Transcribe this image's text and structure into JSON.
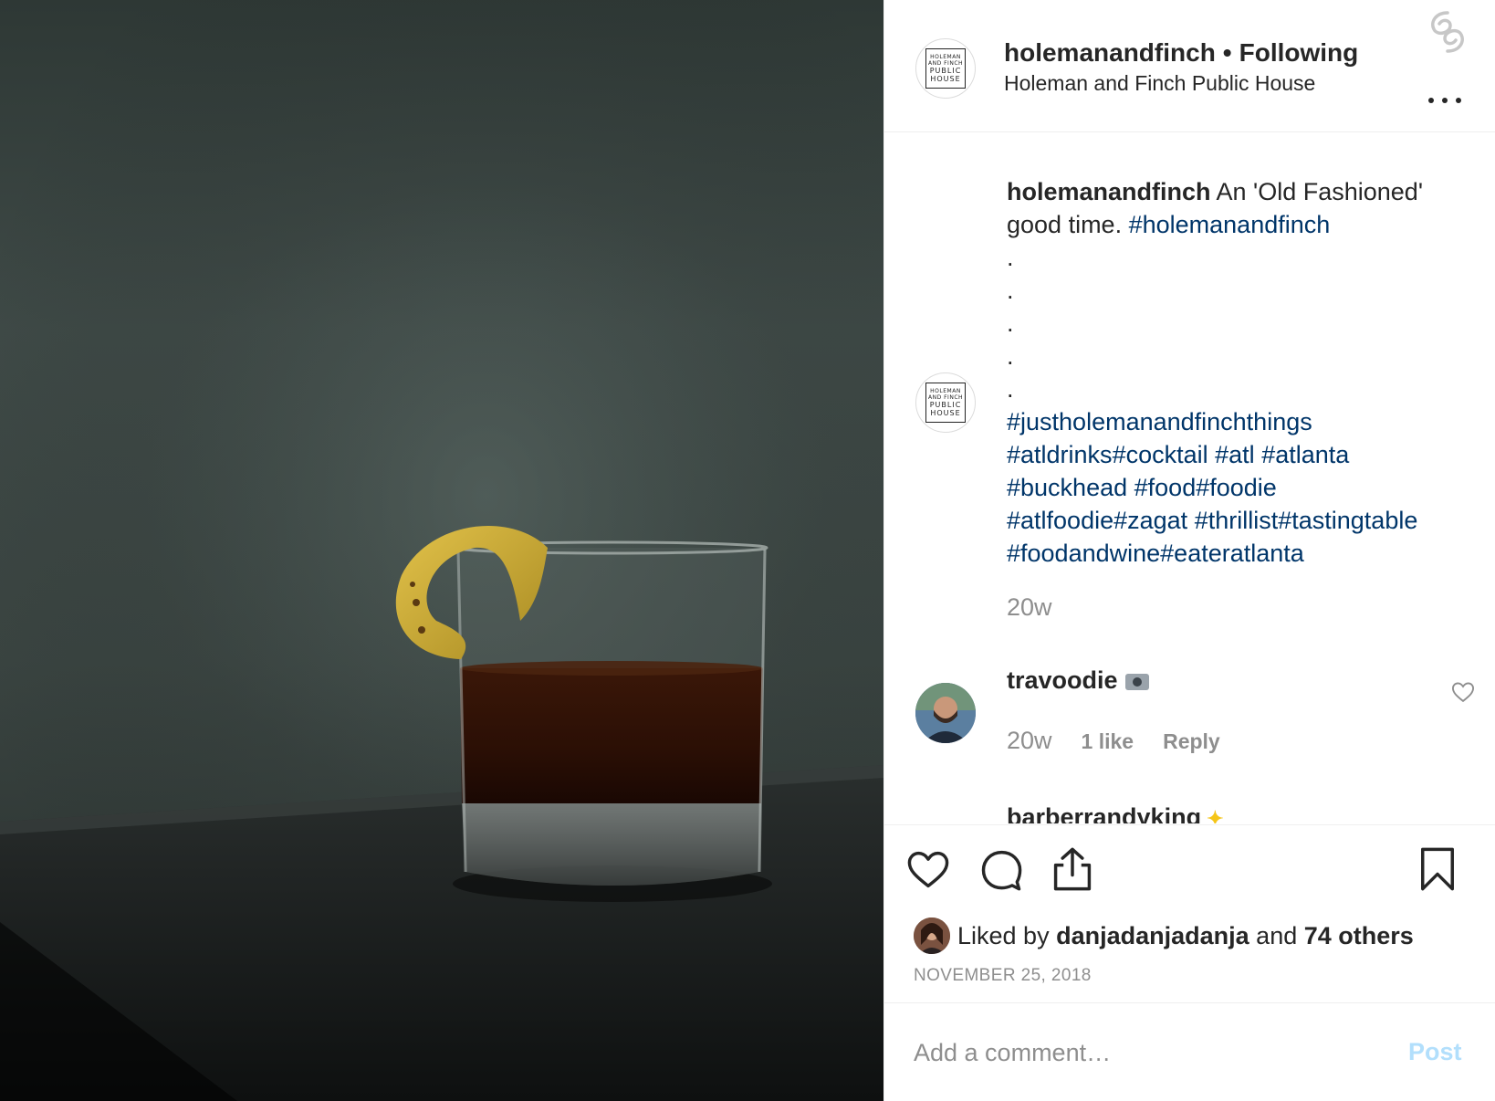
{
  "post": {
    "image_alt": "Old fashioned cocktail with lemon peel on dark table",
    "logo_lines": [
      "HOLEMAN",
      "AND FINCH",
      "PUBLIC",
      "HOUSE"
    ]
  },
  "header": {
    "username": "holemanandfinch",
    "separator": "•",
    "follow_status": "Following",
    "location": "Holeman and Finch Public House",
    "more_label": "...",
    "corner_logo_icon": "spiral-logo-icon"
  },
  "caption": {
    "username": "holemanandfinch",
    "text": "An 'Old Fashioned' good time.",
    "first_tag": "#holemanandfinch",
    "dots": [
      ".",
      ".",
      ".",
      ".",
      "."
    ],
    "tag_lines": [
      [
        "#justholemanandfinchthings"
      ],
      [
        "#atldrinks",
        "#cocktail",
        " ",
        "#atl",
        " ",
        "#atlanta"
      ],
      [
        "#buckhead",
        " ",
        "#food",
        "#foodie"
      ],
      [
        "#atlfoodie",
        "#zagat",
        " ",
        "#thrillist",
        "#tastingtable"
      ],
      [
        "#foodandwine",
        "#eateratlanta"
      ]
    ],
    "age": "20w"
  },
  "comments": [
    {
      "username": "travoodie",
      "age": "20w",
      "likes": "1 like",
      "reply": "Reply"
    },
    {
      "username": "barberrandyking"
    }
  ],
  "actions": {
    "liked_prefix": "Liked by",
    "liked_user": "danjadanjadanja",
    "liked_and": "and",
    "liked_others": "74 others",
    "date": "NOVEMBER 25, 2018"
  },
  "add_comment": {
    "placeholder": "Add a comment…",
    "post_label": "Post"
  },
  "colors": {
    "hashtag": "#003569",
    "muted": "#8e8e8e",
    "post_disabled": "#b2dffc"
  }
}
